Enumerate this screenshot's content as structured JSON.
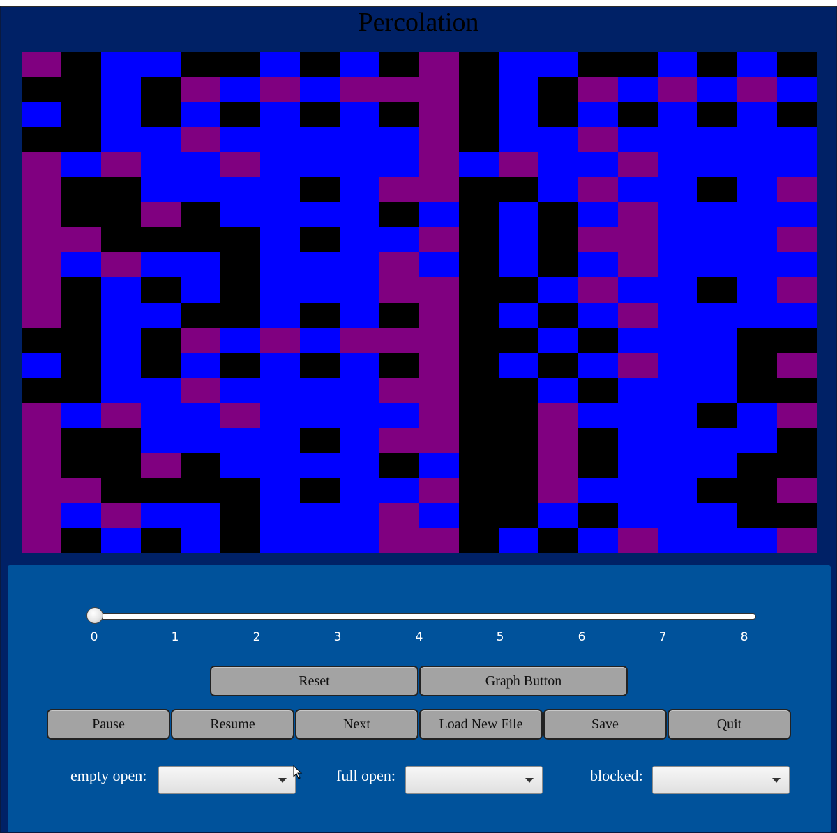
{
  "window": {
    "title": "Percolation"
  },
  "colors": {
    "background": "#002166",
    "panel": "#00529b",
    "empty_open": "#0000ff",
    "full_open": "#800080",
    "blocked": "#000000",
    "button": "#a3a3a3"
  },
  "grid": {
    "rows": 20,
    "cols": 20,
    "legend": {
      "B": "blocked",
      "O": "empty open",
      "F": "full open"
    },
    "cells": [
      "FBOOBBOBOBFBOOBBOBOB",
      "BBOBFOFOFFFBOBFOFOFO",
      "OBOBOBOBOBFBOBOBOBOB",
      "BBOOFOOOOOFBOOFOOOOO",
      "FOFOOFOOOOFOFOOFOOOO",
      "FBBOOOOBOFFBBOFOOBOF",
      "FBBFBOOOOBOBOBOFOOOO",
      "FFBBBBOBOOFBOBFFOOOF",
      "FOFOOBOOOFOBOBOFOOOO",
      "FBOBOBOOOFFBBOFOOBOF",
      "FBOOBBOBOBFBOBOFOOOO",
      "BBOBFOFOFFFBBOBOOOBB",
      "OBOBOBOBOBFBOBOFOOBF",
      "BBOOFOOOOFFBBOBOOOBB",
      "FOFOOFOOOOFBBFOOOBOF",
      "FBBOOOOBOFFBBFBOOOOB",
      "FBBFBOOOOBOBBFBOOOBB",
      "FFBBBBOBOOFBBFOOOBBF",
      "FOFOOBOOOFOBBOBOOOBB",
      "FBOBOBOOOFFBOBOFOOOF"
    ]
  },
  "slider": {
    "value": 0,
    "min": 0,
    "max": 8,
    "ticks": [
      "0",
      "1",
      "2",
      "3",
      "4",
      "5",
      "6",
      "7",
      "8"
    ]
  },
  "buttons": {
    "row1": [
      "Reset",
      "Graph Button"
    ],
    "row2": [
      "Pause",
      "Resume",
      "Next",
      "Load New File",
      "Save",
      "Quit"
    ]
  },
  "dropdowns": [
    {
      "label": "empty open:",
      "value": ""
    },
    {
      "label": "full open:",
      "value": ""
    },
    {
      "label": "blocked:",
      "value": ""
    }
  ]
}
